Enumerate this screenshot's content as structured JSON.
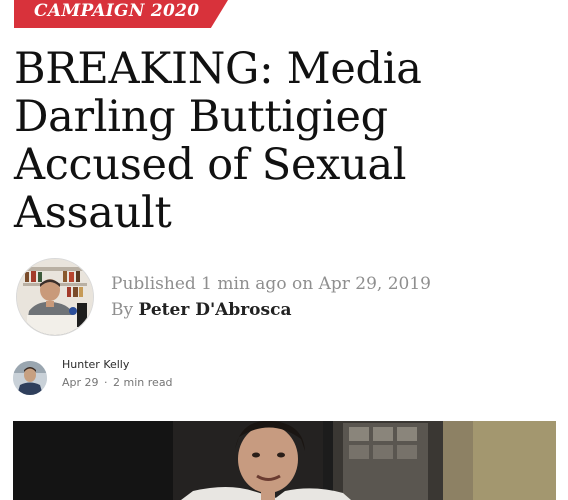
{
  "article": {
    "category": "CAMPAIGN 2020",
    "headline": "BREAKING: Media Darling Buttigieg Accused of Sexual Assault",
    "published_prefix": "Published",
    "published_relative": "1 min ago",
    "published_on_word": "on",
    "published_date": "Apr 29, 2019",
    "by_prefix": "By",
    "author_name": "Peter D'Abrosca"
  },
  "post": {
    "poster_name": "Hunter Kelly",
    "date": "Apr 29",
    "separator": "·",
    "read_time": "2 min read"
  },
  "colors": {
    "category_tag": "#d8323b",
    "headline_text": "#111111",
    "meta_text": "#8f8f8f"
  }
}
